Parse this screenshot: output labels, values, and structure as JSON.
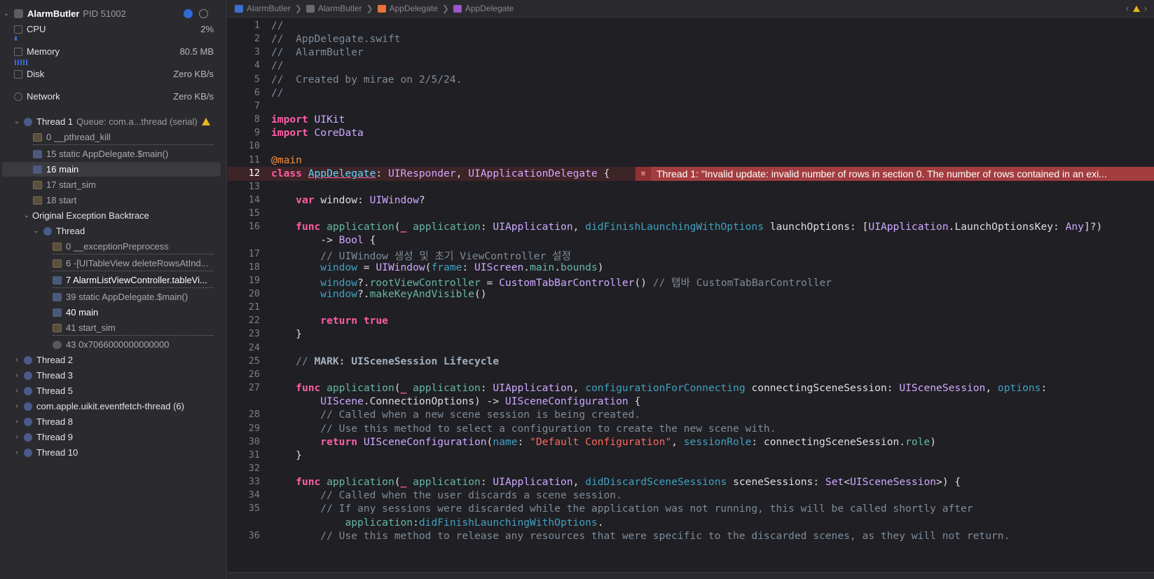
{
  "process": {
    "name": "AlarmButler",
    "pid": "PID 51002"
  },
  "gauges": [
    {
      "label": "CPU",
      "value": "2%"
    },
    {
      "label": "Memory",
      "value": "80.5 MB"
    },
    {
      "label": "Disk",
      "value": "Zero KB/s"
    },
    {
      "label": "Network",
      "value": "Zero KB/s"
    }
  ],
  "thread1": {
    "label": "Thread 1",
    "queue": "Queue: com.a...thread (serial)"
  },
  "thread1_frames": [
    "0 __pthread_kill",
    "15 static AppDelegate.$main()",
    "16 main",
    "17 start_sim",
    "18 start"
  ],
  "backtrace": {
    "label": "Original Exception Backtrace",
    "thread": "Thread"
  },
  "backtrace_frames": [
    "0 __exceptionPreprocess",
    "6 -[UITableView deleteRowsAtInd...",
    "7 AlarmListViewController.tableVi...",
    "39 static AppDelegate.$main()",
    "40 main",
    "41 start_sim",
    "43 0x7066000000000000"
  ],
  "other_threads": [
    "Thread 2",
    "Thread 3",
    "Thread 5",
    "com.apple.uikit.eventfetch-thread (6)",
    "Thread 8",
    "Thread 9",
    "Thread 10"
  ],
  "jumpbar": [
    "AlarmButler",
    "AlarmButler",
    "AppDelegate",
    "AppDelegate"
  ],
  "error": {
    "text": "Thread 1: \"Invalid update: invalid number of rows in section 0. The number of rows contained in an exi..."
  },
  "current_line": 12,
  "code_lines": [
    {
      "n": "1",
      "t": "//"
    },
    {
      "n": "2",
      "t": "//  AppDelegate.swift"
    },
    {
      "n": "3",
      "t": "//  AlarmButler"
    },
    {
      "n": "4",
      "t": "//"
    },
    {
      "n": "5",
      "t": "//  Created by mirae on 2/5/24."
    },
    {
      "n": "6",
      "t": "//"
    },
    {
      "n": "7",
      "t": ""
    },
    {
      "n": "8",
      "t": "import UIKit"
    },
    {
      "n": "9",
      "t": "import CoreData"
    },
    {
      "n": "10",
      "t": ""
    },
    {
      "n": "11",
      "t": "@main"
    },
    {
      "n": "12",
      "t": "class AppDelegate: UIResponder, UIApplicationDelegate {"
    },
    {
      "n": "13",
      "t": ""
    },
    {
      "n": "14",
      "t": "    var window: UIWindow?"
    },
    {
      "n": "15",
      "t": ""
    },
    {
      "n": "16",
      "t": "    func application(_ application: UIApplication, didFinishLaunchingWithOptions launchOptions: [UIApplication.LaunchOptionsKey: Any]?)"
    },
    {
      "n": "",
      "t": "        -> Bool {"
    },
    {
      "n": "17",
      "t": "        // UIWindow 생성 및 초기 ViewController 설정"
    },
    {
      "n": "18",
      "t": "        window = UIWindow(frame: UIScreen.main.bounds)"
    },
    {
      "n": "19",
      "t": "        window?.rootViewController = CustomTabBarController() // 탭바 CustomTabBarController"
    },
    {
      "n": "20",
      "t": "        window?.makeKeyAndVisible()"
    },
    {
      "n": "21",
      "t": ""
    },
    {
      "n": "22",
      "t": "        return true"
    },
    {
      "n": "23",
      "t": "    }"
    },
    {
      "n": "24",
      "t": ""
    },
    {
      "n": "25",
      "t": "    // MARK: UISceneSession Lifecycle"
    },
    {
      "n": "26",
      "t": ""
    },
    {
      "n": "27",
      "t": "    func application(_ application: UIApplication, configurationForConnecting connectingSceneSession: UISceneSession, options:"
    },
    {
      "n": "",
      "t": "        UIScene.ConnectionOptions) -> UISceneConfiguration {"
    },
    {
      "n": "28",
      "t": "        // Called when a new scene session is being created."
    },
    {
      "n": "29",
      "t": "        // Use this method to select a configuration to create the new scene with."
    },
    {
      "n": "30",
      "t": "        return UISceneConfiguration(name: \"Default Configuration\", sessionRole: connectingSceneSession.role)"
    },
    {
      "n": "31",
      "t": "    }"
    },
    {
      "n": "32",
      "t": ""
    },
    {
      "n": "33",
      "t": "    func application(_ application: UIApplication, didDiscardSceneSessions sceneSessions: Set<UISceneSession>) {"
    },
    {
      "n": "34",
      "t": "        // Called when the user discards a scene session."
    },
    {
      "n": "35",
      "t": "        // If any sessions were discarded while the application was not running, this will be called shortly after"
    },
    {
      "n": "",
      "t": "            application:didFinishLaunchingWithOptions."
    },
    {
      "n": "36",
      "t": "        // Use this method to release any resources that were specific to the discarded scenes, as they will not return."
    }
  ],
  "colors": {
    "error_banner": "#a33d3f",
    "keyword": "#fc5fa3",
    "comment": "#7f8c98",
    "type": "#d0a8ff",
    "function": "#67b7a4"
  }
}
